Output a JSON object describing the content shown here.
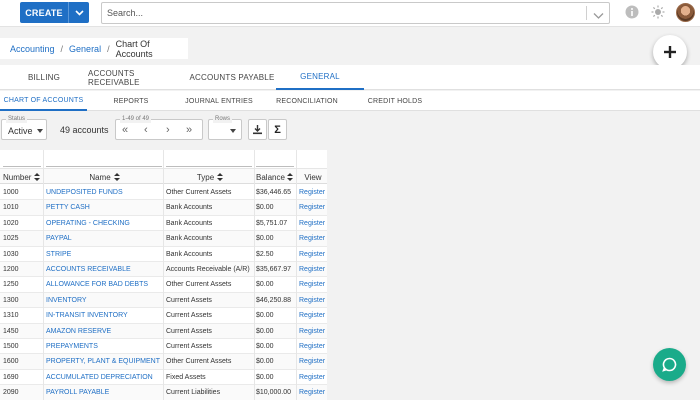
{
  "topbar": {
    "create_label": "CREATE",
    "search_placeholder": "Search...",
    "icons": [
      "chevron-down-icon",
      "info-icon",
      "sun-icon",
      "avatar"
    ]
  },
  "breadcrumb": [
    "Accounting",
    "General",
    "Chart Of Accounts"
  ],
  "primary_tabs": [
    "BILLING",
    "ACCOUNTS RECEIVABLE",
    "ACCOUNTS PAYABLE",
    "GENERAL"
  ],
  "primary_active": "GENERAL",
  "secondary_tabs": [
    "CHART OF ACCOUNTS",
    "REPORTS",
    "JOURNAL ENTRIES",
    "RECONCILIATION",
    "CREDIT HOLDS"
  ],
  "secondary_active": "CHART OF ACCOUNTS",
  "toolbar": {
    "status_legend": "Status",
    "status_value": "Active",
    "count": "49 accounts",
    "pager_legend": "1-49 of 49",
    "rows_legend": "Rows"
  },
  "table": {
    "headers": [
      "Number",
      "Name",
      "Type",
      "Balance",
      "View"
    ],
    "rows": [
      {
        "number": "1000",
        "name": "UNDEPOSITED FUNDS",
        "type": "Other Current Assets",
        "balance": "$36,446.65",
        "view": "Register"
      },
      {
        "number": "1010",
        "name": "PETTY CASH",
        "type": "Bank Accounts",
        "balance": "$0.00",
        "view": "Register"
      },
      {
        "number": "1020",
        "name": "OPERATING - CHECKING",
        "type": "Bank Accounts",
        "balance": "$5,751.07",
        "view": "Register"
      },
      {
        "number": "1025",
        "name": "PAYPAL",
        "type": "Bank Accounts",
        "balance": "$0.00",
        "view": "Register"
      },
      {
        "number": "1030",
        "name": "STRIPE",
        "type": "Bank Accounts",
        "balance": "$2.50",
        "view": "Register"
      },
      {
        "number": "1200",
        "name": "ACCOUNTS RECEIVABLE",
        "type": "Accounts Receivable (A/R)",
        "balance": "$35,667.97",
        "view": "Register"
      },
      {
        "number": "1250",
        "name": "ALLOWANCE FOR BAD DEBTS",
        "type": "Other Current Assets",
        "balance": "$0.00",
        "view": "Register"
      },
      {
        "number": "1300",
        "name": "INVENTORY",
        "type": "Current Assets",
        "balance": "$46,250.88",
        "view": "Register"
      },
      {
        "number": "1310",
        "name": "IN-TRANSIT INVENTORY",
        "type": "Current Assets",
        "balance": "$0.00",
        "view": "Register"
      },
      {
        "number": "1450",
        "name": "AMAZON RESERVE",
        "type": "Current Assets",
        "balance": "$0.00",
        "view": "Register"
      },
      {
        "number": "1500",
        "name": "PREPAYMENTS",
        "type": "Current Assets",
        "balance": "$0.00",
        "view": "Register"
      },
      {
        "number": "1600",
        "name": "PROPERTY, PLANT & EQUIPMENT",
        "type": "Other Current Assets",
        "balance": "$0.00",
        "view": "Register"
      },
      {
        "number": "1690",
        "name": "ACCUMULATED DEPRECIATION",
        "type": "Fixed Assets",
        "balance": "$0.00",
        "view": "Register"
      },
      {
        "number": "2090",
        "name": "PAYROLL PAYABLE",
        "type": "Current Liabilities",
        "balance": "$10,000.00",
        "view": "Register"
      }
    ]
  }
}
